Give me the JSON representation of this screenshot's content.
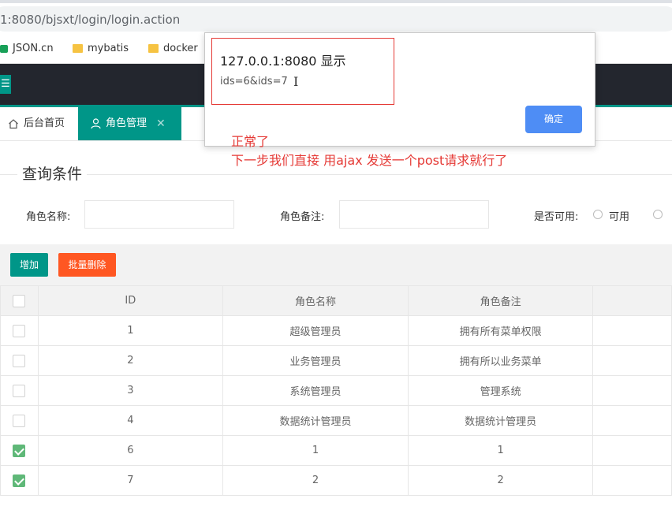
{
  "browser": {
    "url": "1:8080/bjsxt/login/login.action",
    "bookmarks": [
      "JSON.cn",
      "mybatis",
      "docker"
    ]
  },
  "header": {
    "menu_icon": "☰"
  },
  "tabs": [
    {
      "label": "后台首页",
      "icon": "home-icon"
    },
    {
      "label": "角色管理",
      "icon": "user-icon",
      "active": true
    }
  ],
  "search": {
    "legend": "查询条件",
    "name_label": "角色名称:",
    "remark_label": "角色备注:",
    "available_label": "是否可用:",
    "option_available": "可用"
  },
  "toolbar": {
    "add_label": "增加",
    "batch_delete_label": "批量删除"
  },
  "table": {
    "columns": [
      "ID",
      "角色名称",
      "角色备注"
    ],
    "rows": [
      {
        "id": "1",
        "name": "超级管理员",
        "remark": "拥有所有菜单权限",
        "checked": false
      },
      {
        "id": "2",
        "name": "业务管理员",
        "remark": "拥有所以业务菜单",
        "checked": false
      },
      {
        "id": "3",
        "name": "系统管理员",
        "remark": "管理系统",
        "checked": false
      },
      {
        "id": "4",
        "name": "数据统计管理员",
        "remark": "数据统计管理员",
        "checked": false
      },
      {
        "id": "6",
        "name": "1",
        "remark": "1",
        "checked": true
      },
      {
        "id": "7",
        "name": "2",
        "remark": "2",
        "checked": true
      }
    ]
  },
  "dialog": {
    "title": "127.0.0.1:8080 显示",
    "message": "ids=6&ids=7",
    "ok_label": "确定"
  },
  "annotations": {
    "line1": "正常了",
    "line2": "下一步我们直接 用ajax 发送一个post请求就行了"
  },
  "colors": {
    "accent": "#009688",
    "danger": "#ff5722",
    "header": "#23262e",
    "annotation": "#e53935"
  }
}
